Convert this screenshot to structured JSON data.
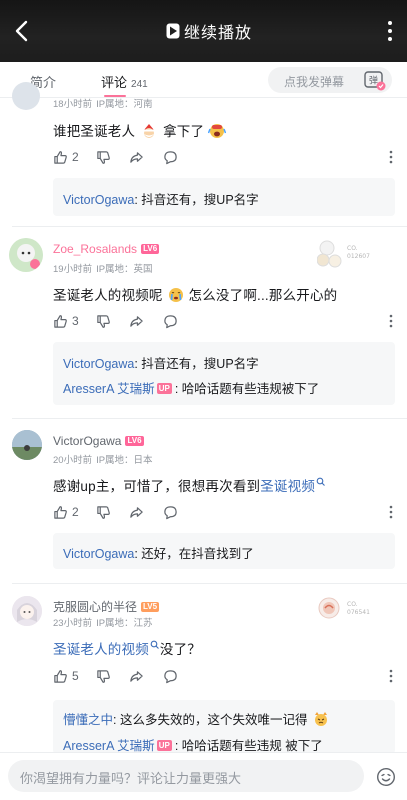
{
  "header": {
    "resume_label": "继续播放"
  },
  "tabs": [
    {
      "label": "简介",
      "count": ""
    },
    {
      "label": "评论",
      "count": "241"
    }
  ],
  "danmaku": {
    "placeholder": "点我发弹幕",
    "toggle_label": "弹"
  },
  "comments": [
    {
      "meta_time": "18小时前",
      "meta_ip": "IP属地：河南",
      "content_parts": [
        "谁把圣诞老人",
        "拿下了"
      ],
      "likes": "2",
      "replies": [
        {
          "user": "VictorOgawa",
          "text": ": 抖音还有，搜UP名字"
        }
      ]
    },
    {
      "username": "Zoe_Rosalands",
      "level": "LV6",
      "meta_time": "19小时前",
      "meta_ip": "IP属地：英国",
      "content_parts": [
        "圣诞老人的视频呢",
        "怎么没了啊...那么开心的"
      ],
      "likes": "3",
      "badge_text": [
        "CO.",
        "012607"
      ],
      "replies": [
        {
          "user": "VictorOgawa",
          "text": ": 抖音还有，搜UP名字"
        },
        {
          "user": "AresserA 艾瑞斯",
          "badge": "UP",
          "text": ": 哈哈话题有些违规被下了"
        }
      ]
    },
    {
      "username": "VictorOgawa",
      "level": "LV6",
      "meta_time": "20小时前",
      "meta_ip": "IP属地：日本",
      "content": "感谢up主，可惜了，很想再次看到",
      "content_link": "圣诞视频",
      "likes": "2",
      "replies": [
        {
          "user": "VictorOgawa",
          "text": ": 还好，在抖音找到了"
        }
      ]
    },
    {
      "username": "克服圆心的半径",
      "level": "LV5",
      "meta_time": "23小时前",
      "meta_ip": "IP属地：江苏",
      "content_link": "圣诞老人的视频",
      "content_tail": "没了？",
      "likes": "5",
      "badge_text": [
        "CO.",
        "076541"
      ],
      "replies": [
        {
          "user": "懵懂之中",
          "text": ": 这么多失效的，这个失效唯一记得"
        },
        {
          "user": "AresserA 艾瑞斯",
          "badge": "UP",
          "text": ": 哈哈话题有些违规 被下了"
        }
      ]
    }
  ],
  "input": {
    "placeholder": "你渴望拥有力量吗？评论让力量更强大"
  },
  "colors": {
    "accent": "#fb7299",
    "link": "#3b6cb8",
    "level6": "#ff6699",
    "level5": "#ff9e5e"
  }
}
